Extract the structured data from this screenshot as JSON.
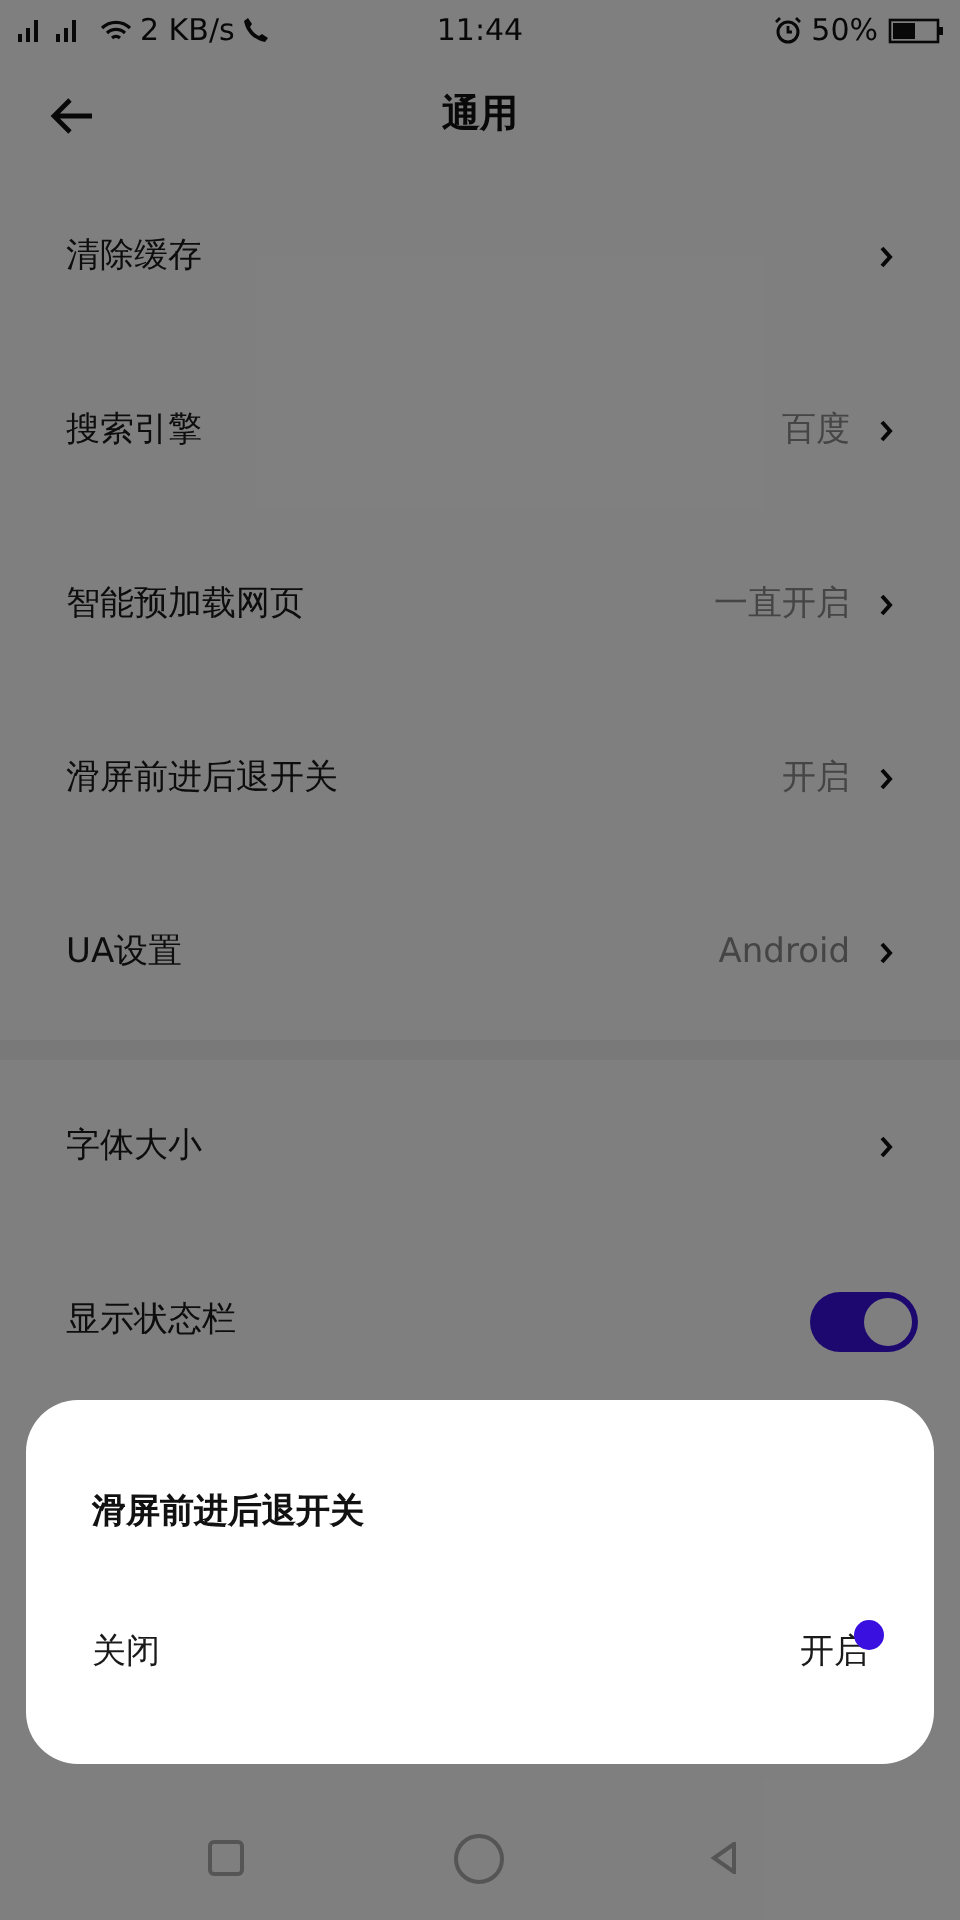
{
  "status_bar": {
    "speed": "2 KB/s",
    "time": "11:44",
    "battery": "50%"
  },
  "header": {
    "title": "通用"
  },
  "groups": [
    {
      "items": [
        {
          "kind": "link",
          "label": "清除缓存"
        },
        {
          "kind": "link",
          "label": "搜索引擎",
          "value": "百度"
        },
        {
          "kind": "link",
          "label": "智能预加载网页",
          "value": "一直开启"
        },
        {
          "kind": "link",
          "label": "滑屏前进后退开关",
          "value": "开启"
        },
        {
          "kind": "link",
          "label": "UA设置",
          "value": "Android"
        }
      ]
    },
    {
      "items": [
        {
          "kind": "link",
          "label": "字体大小"
        },
        {
          "kind": "toggle",
          "label": "显示状态栏",
          "on": true
        }
      ]
    }
  ],
  "dialog": {
    "title": "滑屏前进后退开关",
    "options": [
      {
        "label": "关闭",
        "touched": false
      },
      {
        "label": "开启",
        "touched": true
      }
    ]
  }
}
